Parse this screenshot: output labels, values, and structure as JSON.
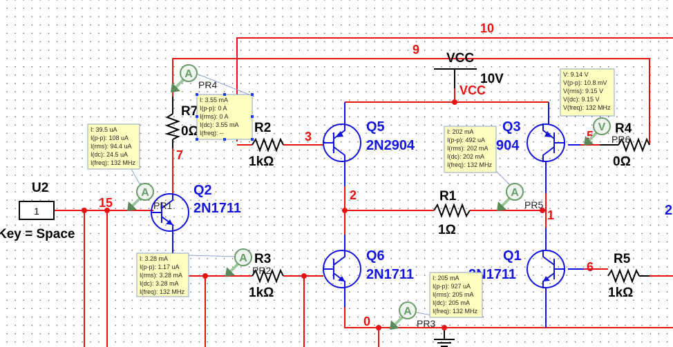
{
  "nets": {
    "n10": "10",
    "n9": "9",
    "n3": "3",
    "n7": "7",
    "n15": "15",
    "n2": "2",
    "n1": "1",
    "n5": "5",
    "n6": "6",
    "n0": "0",
    "n2_right": "2"
  },
  "power": {
    "name": "VCC",
    "value": "10V",
    "net_label": "VCC"
  },
  "source": {
    "ref": "U2",
    "value": "1",
    "key": "Key = Space"
  },
  "resistors": {
    "r7": {
      "ref": "R7",
      "value": "0Ω"
    },
    "r2": {
      "ref": "R2",
      "value": "1kΩ"
    },
    "r1": {
      "ref": "R1",
      "value": "1Ω"
    },
    "r3": {
      "ref": "R3",
      "value": "1kΩ"
    },
    "r4": {
      "ref": "R4",
      "value": "0Ω"
    },
    "r5": {
      "ref": "R5",
      "value": "1kΩ"
    }
  },
  "transistors": {
    "q5": {
      "ref": "Q5",
      "model": "2N2904"
    },
    "q3": {
      "ref": "Q3",
      "model": "904"
    },
    "q2": {
      "ref": "Q2",
      "model": "2N1711"
    },
    "q6": {
      "ref": "Q6",
      "model": "2N1711"
    },
    "q1": {
      "ref": "Q1",
      "model": "2N1711"
    }
  },
  "probes": {
    "pr4": {
      "label": "PR4",
      "type": "A",
      "readings": [
        "I: 3.55 mA",
        "I(p-p): 0 A",
        "I(rms): 0 A",
        "I(dc): 3.55 mA",
        "I(freq): --"
      ]
    },
    "pr1": {
      "label": "PR1",
      "type": "A",
      "readings": [
        "I: 39.5 uA",
        "I(p-p): 108 uA",
        "I(rms): 94.4 uA",
        "I(dc): 24.5 uA",
        "I(freq): 132 MHz"
      ]
    },
    "pr5": {
      "label": "PR5",
      "type": "A",
      "readings": [
        "I: 202 mA",
        "I(p-p): 492 uA",
        "I(rms): 202 mA",
        "I(dc): 202 mA",
        "I(freq): 132 MHz"
      ]
    },
    "pr6": {
      "label": "PR6",
      "type": "V",
      "readings": [
        "V: 9.14 V",
        "V(p-p): 10.8 mV",
        "V(rms): 9.15 V",
        "V(dc): 9.15 V",
        "V(freq): 132 MHz"
      ]
    },
    "pr2": {
      "label": "PR2",
      "type": "A",
      "readings": [
        "I: 3.28 mA",
        "I(p-p): 1.17 uA",
        "I(rms): 3.28 mA",
        "I(dc): 3.28 mA",
        "I(freq): 132 MHz"
      ]
    },
    "pr3": {
      "label": "PR3",
      "type": "A",
      "readings": [
        "I: 205 mA",
        "I(p-p): 927 uA",
        "I(rms): 205 mA",
        "I(dc): 205 mA",
        "I(freq): 132 MHz"
      ]
    }
  },
  "colors": {
    "wire": "#e81010",
    "component": "#1010e0",
    "probe_box": "#ffffc0",
    "probe": "#6a9a6a"
  }
}
